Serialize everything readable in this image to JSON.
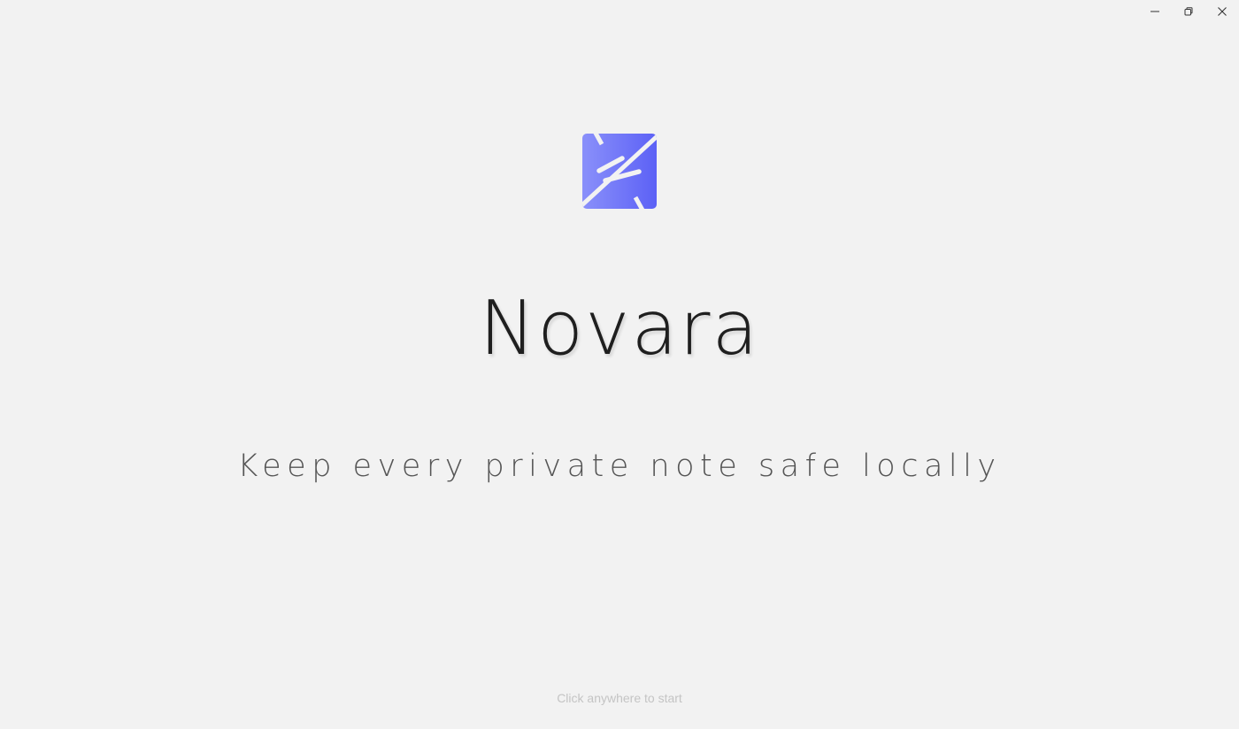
{
  "window": {
    "controls": {
      "minimize_icon": "minimize-icon",
      "restore_icon": "restore-icon",
      "close_icon": "close-icon"
    }
  },
  "splash": {
    "logo_icon": "novara-logo-icon",
    "app_name": "Novara",
    "tagline": "Keep every private note safe locally",
    "start_hint": "Click anywhere to start"
  },
  "colors": {
    "background": "#f2f2f2",
    "logo_gradient_start": "#8a90fa",
    "logo_gradient_end": "#5c61f6",
    "title_text": "#1f1f1f",
    "tagline_text": "#555555",
    "hint_text": "#c4c4c4"
  }
}
